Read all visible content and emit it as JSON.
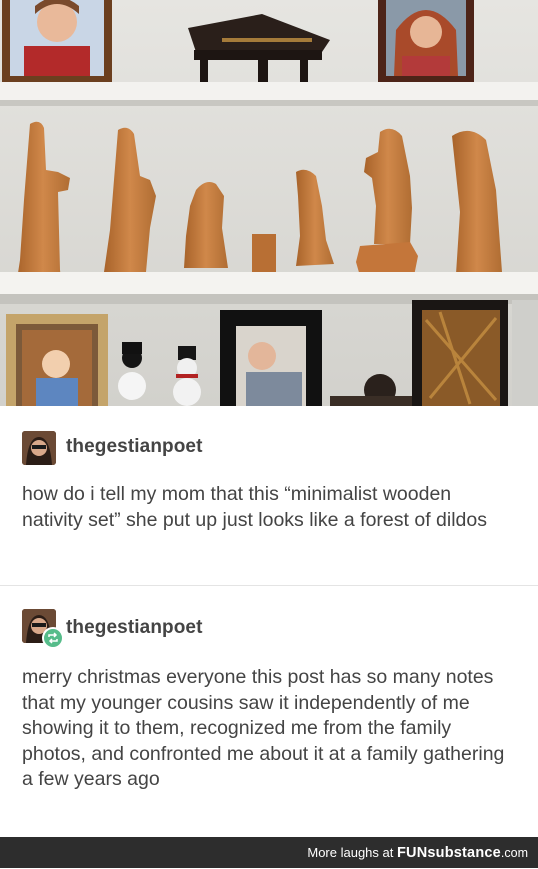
{
  "post1": {
    "username": "thegestianpoet",
    "text": "how do i tell my mom that this “minimalist wooden nativity set” she put up just looks like a forest of dildos"
  },
  "post2": {
    "username": "thegestianpoet",
    "text": "merry christmas everyone this post has so many notes that my younger cousins saw it independently of me showing it to them, recognized me from the family photos, and confronted me about it at a family gathering a few years ago"
  },
  "footer": {
    "prefix": "More laughs at ",
    "brand": "FUNsubstance",
    "domain": ".com"
  },
  "colors": {
    "text": "#444444",
    "reblog_badge": "#56bc8a",
    "footer_bg": "#2d2d2d"
  }
}
